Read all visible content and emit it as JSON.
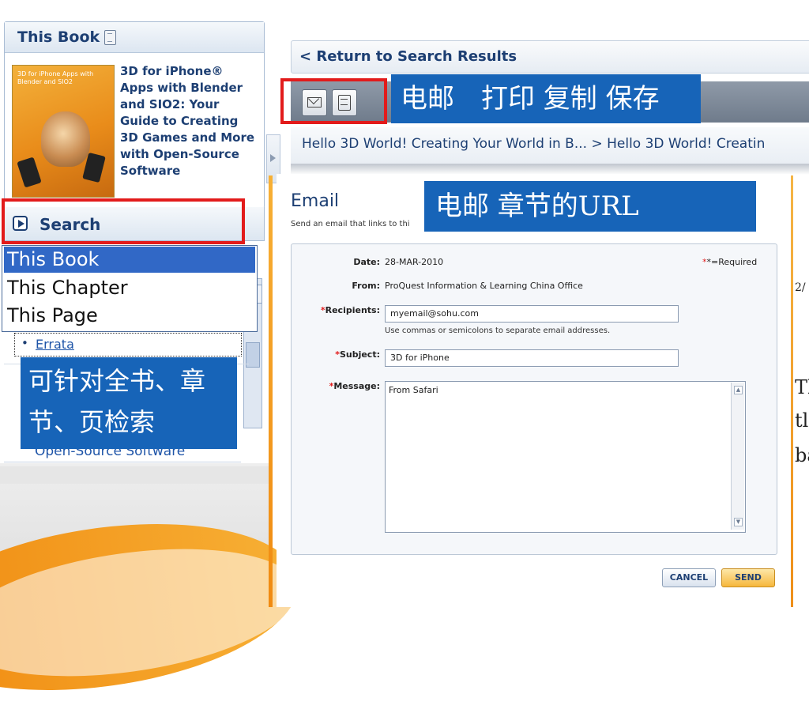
{
  "sidebar": {
    "book_box_title": "This Book",
    "cover_text": "3D for iPhone Apps with Blender and SIO2",
    "book_title": "3D for iPhone® Apps with Blender and SIO2: Your Guide to Creating 3D Games and More with Open-Source Software",
    "search_label": "Search",
    "search_scope_options": [
      "This Book",
      "This Chapter",
      "This Page"
    ],
    "search_scope_selected": "This Book",
    "errata_label": "Errata",
    "partial_title_text": "Open-Source Software"
  },
  "annotations": {
    "toolbar_callout": "电邮　打印 复制 保存",
    "toolbar_callout_overflow": "存",
    "email_callout": "电邮 章节的URL",
    "search_callout": "可针对全书、章节、页检索"
  },
  "main": {
    "return_link": "< Return to Search Results",
    "toolbar_buttons": [
      {
        "name": "email",
        "icon": "envelope-icon"
      },
      {
        "name": "print",
        "icon": "printer-icon"
      }
    ],
    "breadcrumb": "Hello 3D World! Creating Your World in B... > Hello 3D World! Creatin",
    "email_form": {
      "title": "Email",
      "subtitle": "Send an email that links to thi",
      "required_note": "*=Required",
      "date_label": "Date:",
      "date_value": "28-MAR-2010",
      "from_label": "From:",
      "from_value": "ProQuest Information & Learning China Office",
      "recipients_label": "Recipients:",
      "recipients_value": "myemail@sohu.com",
      "recipients_hint": "Use commas or semicolons to separate email addresses.",
      "subject_label": "Subject:",
      "subject_value": "3D for iPhone",
      "message_label": "Message:",
      "message_value": "From Safari",
      "cancel_label": "CANCEL",
      "send_label": "SEND"
    },
    "page_text_fragments": [
      "2/",
      "Th",
      "tl",
      "ba"
    ]
  },
  "colors": {
    "accent_blue": "#1764b8",
    "highlight_red": "#e21b1b",
    "nav_text": "#1d3f73",
    "selection_blue": "#3168c6",
    "orange": "#f08a10"
  }
}
